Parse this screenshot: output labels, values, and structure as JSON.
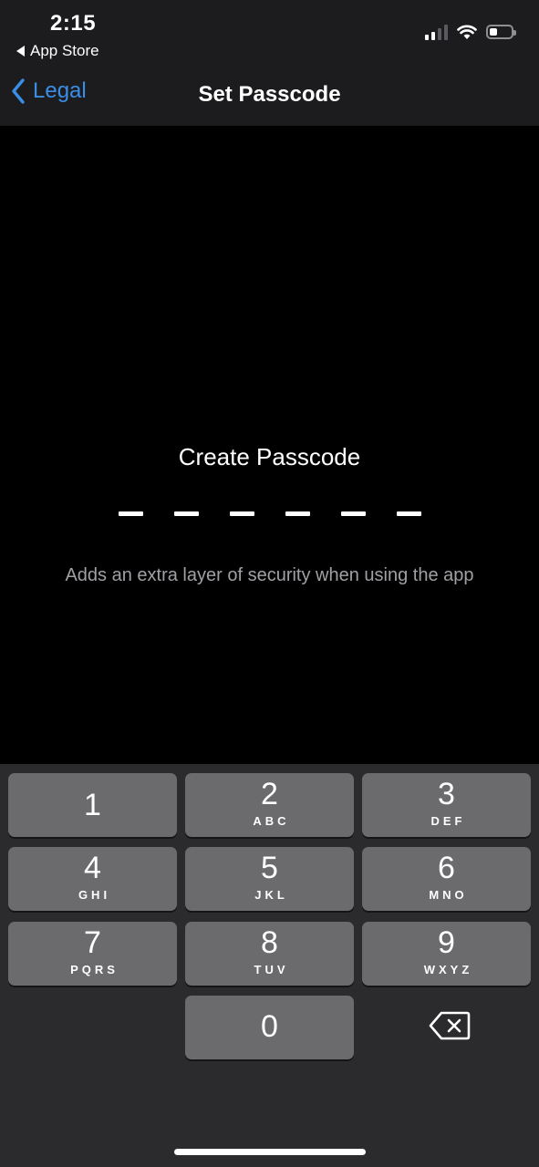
{
  "status_bar": {
    "time": "2:15",
    "back_app": "App Store",
    "battery_level": 0.35
  },
  "nav": {
    "back_label": "Legal",
    "title": "Set Passcode"
  },
  "passcode": {
    "prompt": "Create Passcode",
    "length": 6,
    "subtitle": "Adds an extra layer of security when using the app"
  },
  "keypad": {
    "keys": [
      {
        "digit": "1",
        "letters": ""
      },
      {
        "digit": "2",
        "letters": "ABC"
      },
      {
        "digit": "3",
        "letters": "DEF"
      },
      {
        "digit": "4",
        "letters": "GHI"
      },
      {
        "digit": "5",
        "letters": "JKL"
      },
      {
        "digit": "6",
        "letters": "MNO"
      },
      {
        "digit": "7",
        "letters": "PQRS"
      },
      {
        "digit": "8",
        "letters": "TUV"
      },
      {
        "digit": "9",
        "letters": "WXYZ"
      },
      {
        "digit": "0",
        "letters": ""
      }
    ],
    "delete_icon": "backspace-icon"
  },
  "colors": {
    "accent": "#3a8ee6",
    "key_bg": "#6b6b6e",
    "keypad_bg": "#2b2b2d"
  }
}
